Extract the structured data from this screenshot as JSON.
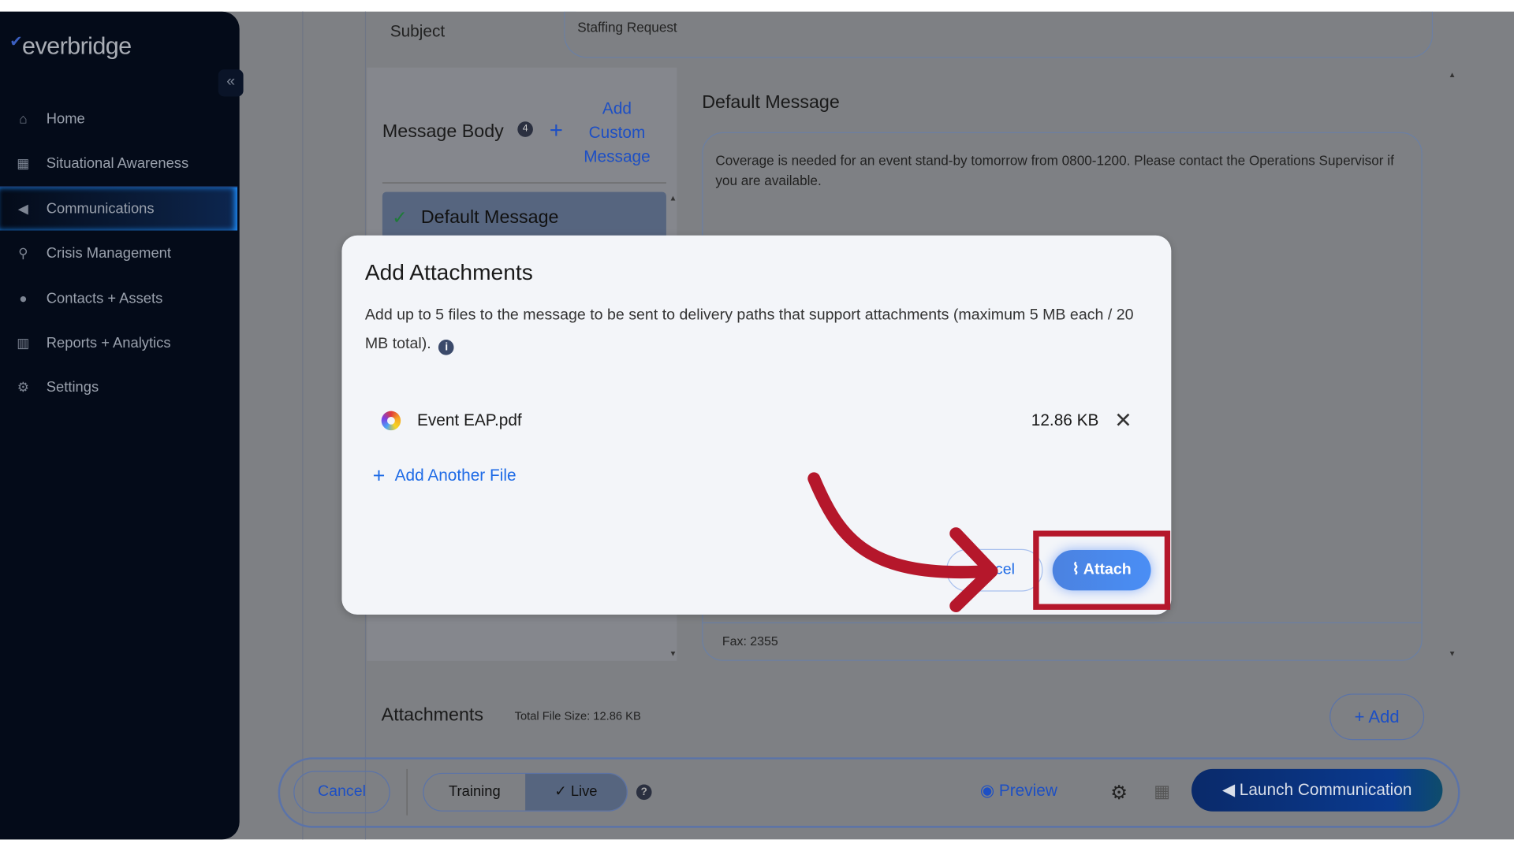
{
  "sidebar": {
    "logo": "everbridge",
    "collapse_icon": "double-chevron-left",
    "items": [
      {
        "label": "Home",
        "icon": "home"
      },
      {
        "label": "Situational Awareness",
        "icon": "map"
      },
      {
        "label": "Communications",
        "icon": "megaphone",
        "active": true
      },
      {
        "label": "Crisis Management",
        "icon": "route"
      },
      {
        "label": "Contacts + Assets",
        "icon": "map-pin"
      },
      {
        "label": "Reports + Analytics",
        "icon": "bar-chart"
      },
      {
        "label": "Settings",
        "icon": "gear"
      }
    ]
  },
  "form": {
    "subject_label": "Subject",
    "subject_value": "Staffing Request",
    "message_body_label": "Message Body",
    "message_body_count": "4",
    "add_custom_message": "Add Custom Message",
    "default_message_tab": "Default Message",
    "default_message_title": "Default Message",
    "default_message_text": "Coverage is needed for an event stand-by tomorrow from 0800-1200. Please contact the Operations Supervisor if you are available.",
    "fax": "Fax: 2355",
    "attachments_title": "Attachments",
    "total_file_size": "Total File Size: 12.86 KB",
    "add_label": "Add"
  },
  "footer": {
    "cancel": "Cancel",
    "training": "Training",
    "live": "Live",
    "mode_selected": "Live",
    "preview": "Preview",
    "launch": "Launch Communication"
  },
  "modal": {
    "title": "Add Attachments",
    "description": "Add up to 5 files to the message to be sent to delivery paths that support attachments (maximum 5 MB each / 20 MB total).",
    "files": [
      {
        "name": "Event EAP.pdf",
        "size": "12.86 KB"
      }
    ],
    "add_another": "Add Another File",
    "cancel": "cel",
    "attach": "Attach"
  },
  "annotation": {
    "color": "#b5172b",
    "target": "Attach"
  }
}
